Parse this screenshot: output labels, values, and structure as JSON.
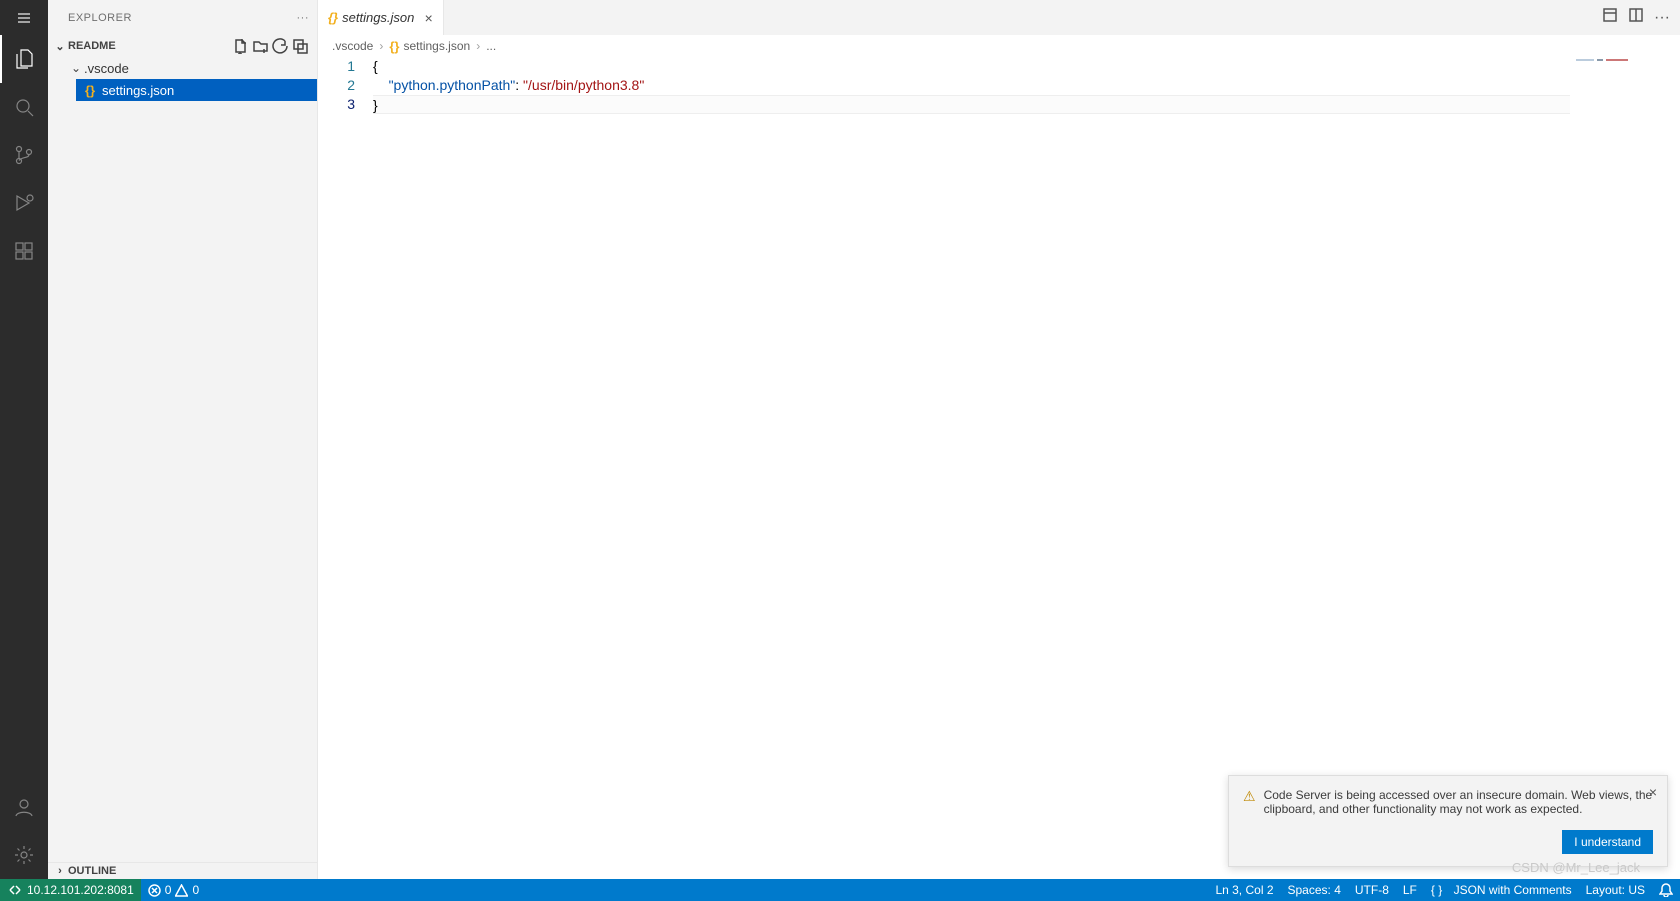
{
  "sidebar": {
    "title": "EXPLORER",
    "workspace_name": "README",
    "tree": {
      "folder": {
        "name": ".vscode",
        "expanded": true
      },
      "file": {
        "name": "settings.json"
      }
    },
    "outline_label": "OUTLINE"
  },
  "tabs": {
    "open": [
      {
        "name": "settings.json",
        "icon": "json"
      }
    ]
  },
  "breadcrumbs": {
    "items": [
      ".vscode",
      "settings.json",
      "..."
    ]
  },
  "editor": {
    "lines": [
      "1",
      "2",
      "3"
    ],
    "code": {
      "brace_open": "{",
      "key": "\"python.pythonPath\"",
      "colon": ":",
      "value": "\"/usr/bin/python3.8\"",
      "brace_close": "}"
    }
  },
  "notification": {
    "text": "Code Server is being accessed over an insecure domain. Web views, the clipboard, and other functionality may not work as expected.",
    "action": "I understand"
  },
  "statusbar": {
    "remote": "10.12.101.202:8081",
    "errors": "0",
    "warnings": "0",
    "position": "Ln 3, Col 2",
    "spaces": "Spaces: 4",
    "encoding": "UTF-8",
    "eol": "LF",
    "lang": "JSON with Comments",
    "layout": "Layout: US",
    "lang_icon": "{ }"
  },
  "watermark": "CSDN @Mr_Lee_jack"
}
